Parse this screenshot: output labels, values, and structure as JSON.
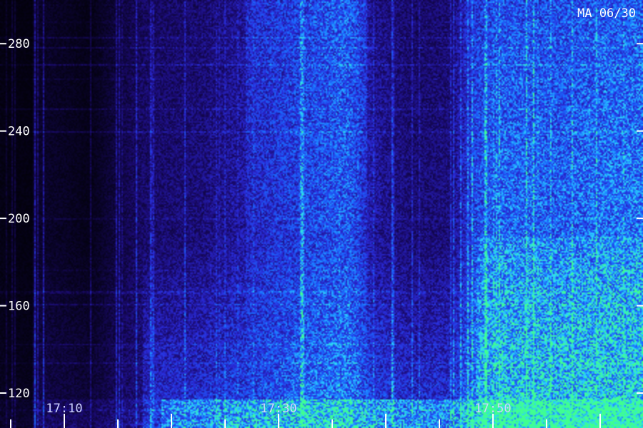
{
  "chart_data": {
    "type": "heatmap",
    "title": "MA 06/30",
    "xlabel": "",
    "ylabel": "",
    "x_ticks": [
      "17:10",
      "17:30",
      "17:50"
    ],
    "y_ticks": [
      120,
      160,
      200,
      240,
      280
    ],
    "ylim": [
      104,
      300
    ],
    "xlim_minutes": [
      1024,
      1084
    ],
    "x_tick_minutes": [
      1030,
      1050,
      1070
    ],
    "grid": false,
    "colormap": [
      "#000000",
      "#1a0a6e",
      "#2a2ad8",
      "#1a6cff",
      "#2cd4ff",
      "#40ff90"
    ],
    "colors": {
      "tick": "#ffffff",
      "label": "#ffffff",
      "x_label": "#cfd3ff"
    }
  }
}
